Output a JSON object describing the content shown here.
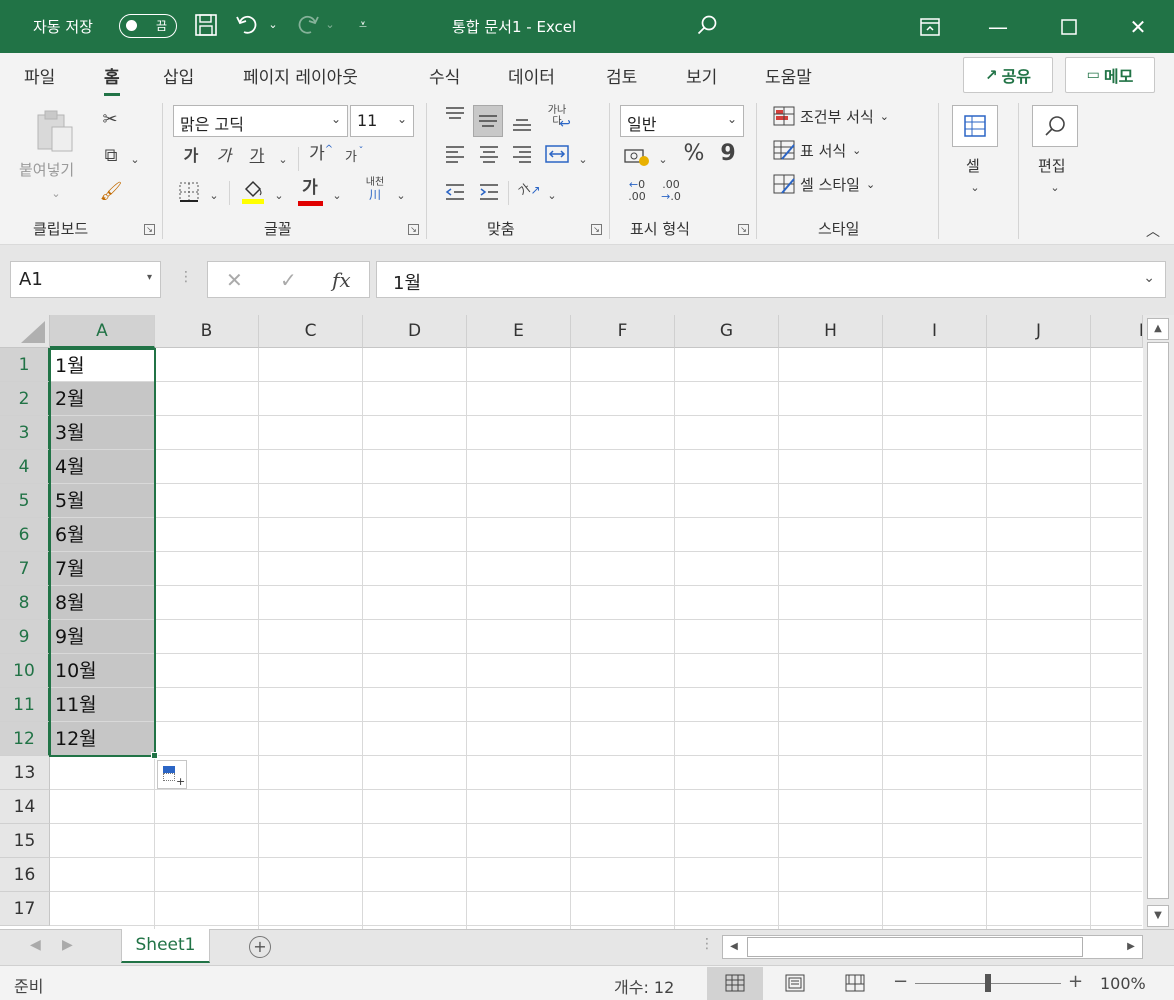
{
  "titlebar": {
    "autosave_label": "자동 저장",
    "autosave_state": "끔",
    "document_title": "통합 문서1  -  Excel"
  },
  "tabs": [
    {
      "label": "파일",
      "active": false
    },
    {
      "label": "홈",
      "active": true
    },
    {
      "label": "삽입",
      "active": false
    },
    {
      "label": "페이지 레이아웃",
      "active": false
    },
    {
      "label": "수식",
      "active": false
    },
    {
      "label": "데이터",
      "active": false
    },
    {
      "label": "검토",
      "active": false
    },
    {
      "label": "보기",
      "active": false
    },
    {
      "label": "도움말",
      "active": false
    }
  ],
  "share_label": "공유",
  "memo_label": "메모",
  "ribbon": {
    "clipboard": {
      "group_label": "클립보드",
      "paste_label": "붙여넣기"
    },
    "font": {
      "group_label": "글꼴",
      "font_name": "맑은 고딕",
      "font_size": "11",
      "bold": "가",
      "italic": "가",
      "underline": "가",
      "grow": "가",
      "shrink": "가",
      "font_color": "가",
      "phonetic_top": "내천",
      "phonetic_bottom": "川"
    },
    "alignment": {
      "group_label": "맞춤",
      "wrap_top": "가나",
      "wrap_bottom": "다",
      "orient_text": "가"
    },
    "number": {
      "group_label": "표시 형식",
      "format": "일반",
      "percent": "%",
      "comma": "9",
      "inc_decimal_top": "0",
      "inc_decimal_bottom": ".00",
      "dec_decimal_top": ".00",
      "dec_decimal_bottom": ".0"
    },
    "styles": {
      "group_label": "스타일",
      "conditional": "조건부 서식",
      "table_format": "표 서식",
      "cell_styles": "셀 스타일"
    },
    "cells": {
      "label": "셀"
    },
    "editing": {
      "label": "편집"
    }
  },
  "formula_bar": {
    "name_box": "A1",
    "cancel": "✕",
    "enter": "✓",
    "fx": "fx",
    "content": "1월"
  },
  "sheet": {
    "columns": [
      "A",
      "B",
      "C",
      "D",
      "E",
      "F",
      "G",
      "H",
      "I",
      "J"
    ],
    "partial_column": "K",
    "rows": [
      "1",
      "2",
      "3",
      "4",
      "5",
      "6",
      "7",
      "8",
      "9",
      "10",
      "11",
      "12",
      "13",
      "14",
      "15",
      "16",
      "17"
    ],
    "column_a_values": [
      "1월",
      "2월",
      "3월",
      "4월",
      "5월",
      "6월",
      "7월",
      "8월",
      "9월",
      "10월",
      "11월",
      "12월"
    ],
    "selected_range": "A1:A12"
  },
  "sheet_tabs": {
    "active": "Sheet1",
    "add": "+"
  },
  "statusbar": {
    "ready": "준비",
    "count": "개수: 12",
    "zoom_minus": "−",
    "zoom_plus": "+",
    "zoom": "100%"
  },
  "accent_color": "#217346"
}
